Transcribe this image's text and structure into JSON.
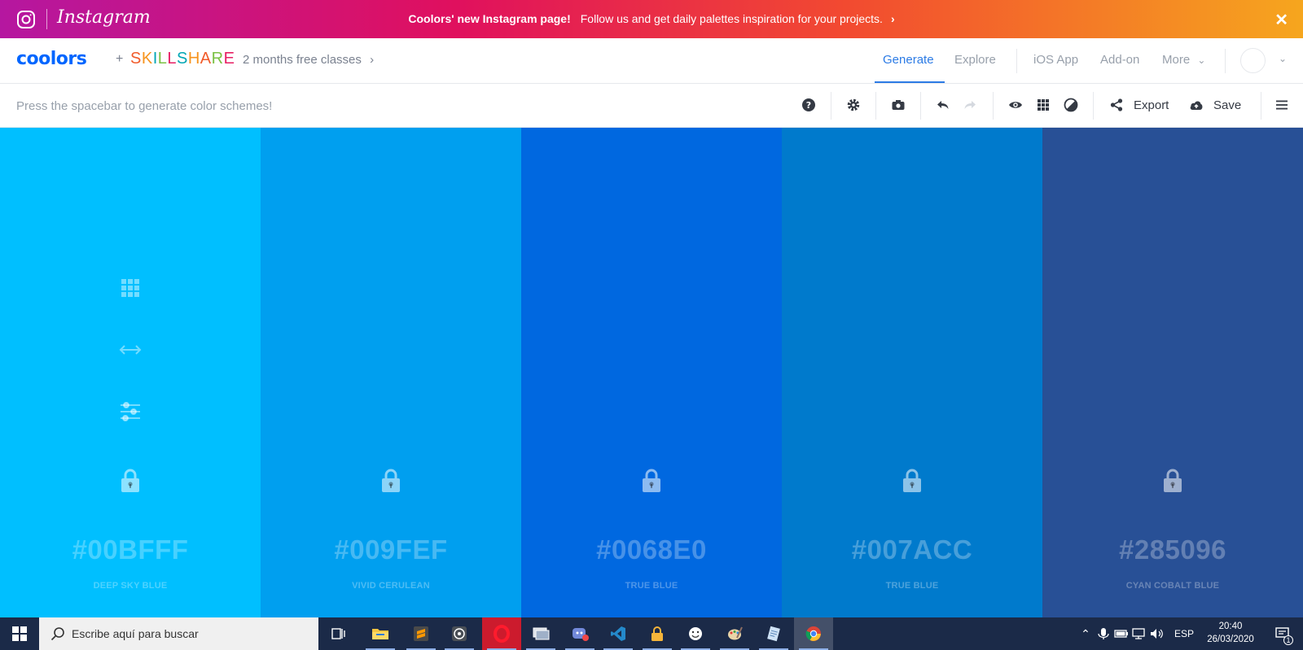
{
  "banner": {
    "brand": "Instagram",
    "bold_text": "Coolors' new Instagram page!",
    "text": "Follow us and get daily palettes inspiration for your projects.",
    "close_symbol": "✕"
  },
  "nav": {
    "logo": "coolors",
    "plus": "+",
    "partner": "SKILLSHARE",
    "promo": "2 months free classes",
    "links": [
      "Generate",
      "Explore",
      "iOS App",
      "Add-on",
      "More"
    ],
    "active_link": "Generate"
  },
  "toolbar": {
    "hint": "Press the spacebar to generate color schemes!",
    "export_label": "Export",
    "save_label": "Save",
    "icons": [
      "help-icon",
      "settings-icon",
      "camera-icon",
      "undo-icon",
      "redo-icon",
      "eye-icon",
      "grid-icon",
      "contrast-icon",
      "share-icon",
      "cloud-upload-icon",
      "hamburger-menu-icon"
    ]
  },
  "palette": {
    "swatches": [
      {
        "hex": "#00BFFF",
        "name": "DEEP SKY BLUE",
        "color": "#00bfff",
        "show_tools": true
      },
      {
        "hex": "#009FEF",
        "name": "VIVID CERULEAN",
        "color": "#009fef",
        "show_tools": false
      },
      {
        "hex": "#0068E0",
        "name": "TRUE BLUE",
        "color": "#0068e0",
        "show_tools": false
      },
      {
        "hex": "#007ACC",
        "name": "TRUE BLUE",
        "color": "#007acc",
        "show_tools": false
      },
      {
        "hex": "#285096",
        "name": "CYAN COBALT BLUE",
        "color": "#285096",
        "show_tools": false
      }
    ]
  },
  "taskbar": {
    "search_placeholder": "Escribe aquí para buscar",
    "apps": [
      "task-view-icon",
      "file-explorer-icon",
      "sublime-text-icon",
      "whatsapp-icon",
      "opera-icon",
      "network-app-icon",
      "discord-icon",
      "vscode-icon",
      "password-manager-icon",
      "emoji-app-icon",
      "paint-icon",
      "notepad-icon",
      "chrome-icon"
    ],
    "language": "ESP",
    "time": "20:40",
    "date": "26/03/2020",
    "notification_count": "1"
  },
  "colors": {
    "accent": "#2c7be5",
    "coolors_blue": "#0066ff",
    "skillshare_letters": [
      "#f15b2a",
      "#f7941d",
      "#00a6b4",
      "#7ac143",
      "#e71e63",
      "#00a6b4",
      "#f7941d",
      "#f15b2a",
      "#7ac143",
      "#e71e63"
    ]
  }
}
